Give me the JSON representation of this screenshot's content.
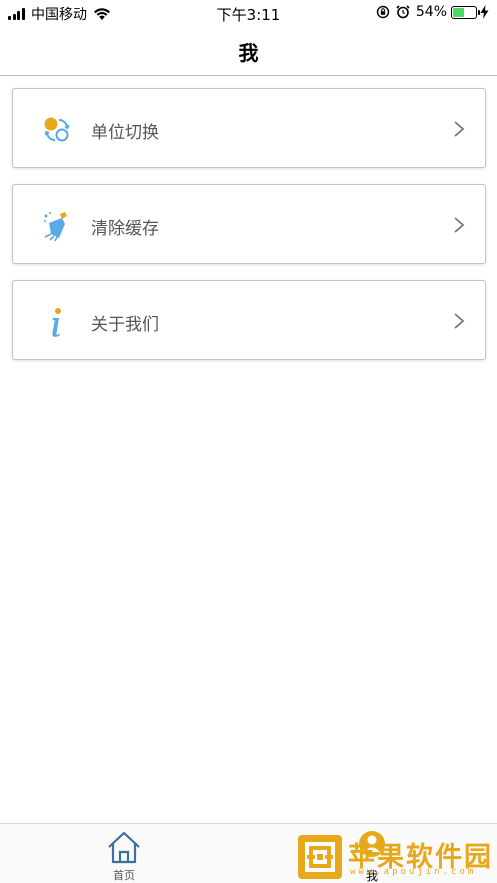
{
  "status_bar": {
    "carrier": "中国移动",
    "time": "下午3:11",
    "battery_percent": "54%",
    "battery_level": 0.54
  },
  "nav": {
    "title": "我"
  },
  "menu": {
    "items": [
      {
        "label": "单位切换",
        "icon": "unit-switch-icon"
      },
      {
        "label": "清除缓存",
        "icon": "broom-icon"
      },
      {
        "label": "关于我们",
        "icon": "info-icon"
      }
    ]
  },
  "tabs": [
    {
      "label": "首页",
      "icon": "home-icon"
    },
    {
      "label": "我",
      "icon": "user-icon",
      "active": true
    }
  ],
  "watermark": {
    "text": "苹果软件园",
    "url": "www.apoujin.com"
  },
  "colors": {
    "accent_orange": "#e8a81c",
    "icon_blue": "#5aa9e6",
    "battery_green": "#4cd964"
  }
}
